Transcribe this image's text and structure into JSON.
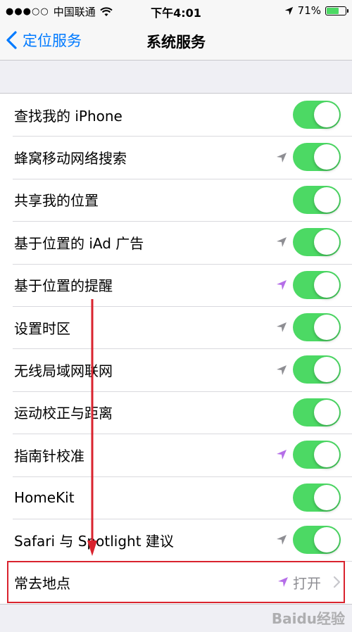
{
  "status_bar": {
    "signal_dots": "●●●○○",
    "carrier": "中国联通",
    "time": "下午4:01",
    "battery_text": "71%",
    "battery_level": 0.71
  },
  "nav": {
    "back_label": "定位服务",
    "title": "系统服务"
  },
  "rows": [
    {
      "label": "查找我的 iPhone",
      "loc_icon": "none",
      "toggle_on": true
    },
    {
      "label": "蜂窝移动网络搜索",
      "loc_icon": "gray",
      "toggle_on": true
    },
    {
      "label": "共享我的位置",
      "loc_icon": "none",
      "toggle_on": true
    },
    {
      "label": "基于位置的 iAd 广告",
      "loc_icon": "gray",
      "toggle_on": true
    },
    {
      "label": "基于位置的提醒",
      "loc_icon": "purple",
      "toggle_on": true
    },
    {
      "label": "设置时区",
      "loc_icon": "gray",
      "toggle_on": true
    },
    {
      "label": "无线局域网联网",
      "loc_icon": "gray",
      "toggle_on": true
    },
    {
      "label": "运动校正与距离",
      "loc_icon": "none",
      "toggle_on": true
    },
    {
      "label": "指南针校准",
      "loc_icon": "purple",
      "toggle_on": true
    },
    {
      "label": "HomeKit",
      "loc_icon": "none",
      "toggle_on": true
    },
    {
      "label": "Safari 与 Spotlight 建议",
      "loc_icon": "gray",
      "toggle_on": true
    }
  ],
  "frequent_row": {
    "label": "常去地点",
    "value": "打开",
    "loc_icon": "purple"
  },
  "colors": {
    "accent": "#007aff",
    "toggle_on": "#4cd964",
    "loc_gray": "#8e8e93",
    "loc_purple": "#b56ee8",
    "annotation_red": "#d9232e"
  },
  "watermark": "Baidu经验"
}
